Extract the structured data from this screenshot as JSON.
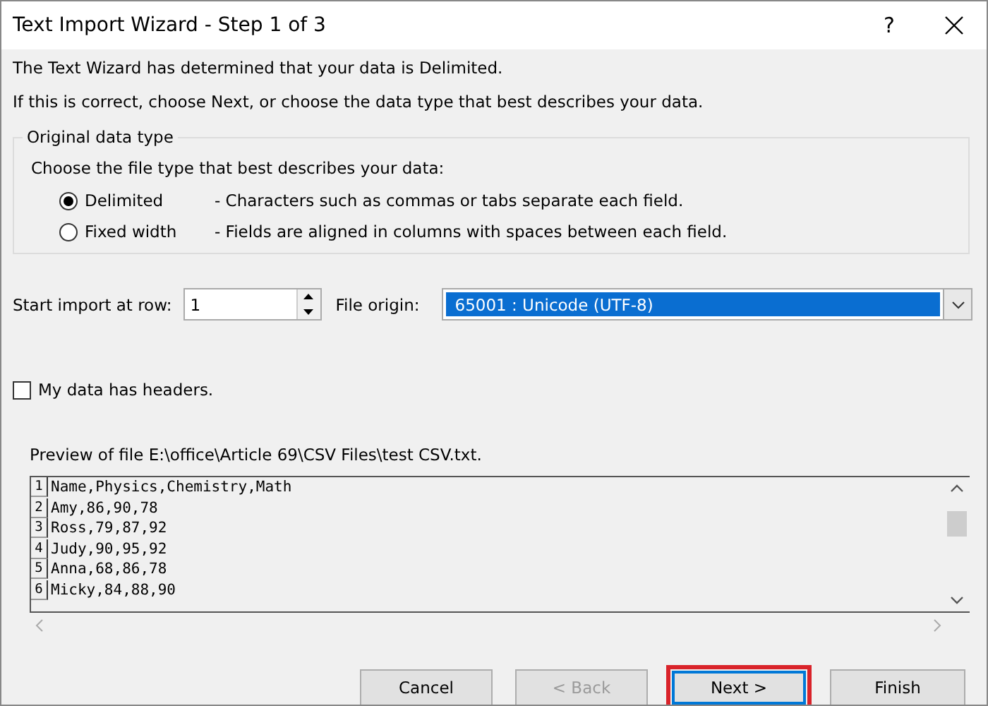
{
  "window": {
    "title": "Text Import Wizard - Step 1 of 3",
    "help": "?"
  },
  "intro": [
    "The Text Wizard has determined that your data is Delimited.",
    "If this is correct, choose Next, or choose the data type that best describes your data."
  ],
  "data_type_group": {
    "legend": "Original data type",
    "prompt": "Choose the file type that best describes your data:",
    "options": [
      {
        "label": "Delimited",
        "description": "- Characters such as commas or tabs separate each field.",
        "selected": true
      },
      {
        "label": "Fixed width",
        "description": "- Fields are aligned in columns with spaces between each field.",
        "selected": false
      }
    ]
  },
  "start_row": {
    "label": "Start import at row:",
    "value": "1"
  },
  "file_origin": {
    "label": "File origin:",
    "value": "65001 : Unicode (UTF-8)"
  },
  "headers_checkbox": {
    "label": "My data has headers.",
    "checked": false
  },
  "preview": {
    "title": "Preview of file E:\\office\\Article 69\\CSV Files\\test CSV.txt.",
    "lines": [
      {
        "number": "1",
        "text": "Name,Physics,Chemistry,Math"
      },
      {
        "number": "2",
        "text": "Amy,86,90,78"
      },
      {
        "number": "3",
        "text": "Ross,79,87,92"
      },
      {
        "number": "4",
        "text": "Judy,90,95,92"
      },
      {
        "number": "5",
        "text": "Anna,68,86,78"
      },
      {
        "number": "6",
        "text": "Micky,84,88,90"
      }
    ]
  },
  "buttons": [
    {
      "label": "Cancel",
      "disabled": false,
      "default": false,
      "highlighted": false
    },
    {
      "label": "< Back",
      "disabled": true,
      "default": false,
      "highlighted": false
    },
    {
      "label": "Next >",
      "disabled": false,
      "default": true,
      "highlighted": true
    },
    {
      "label": "Finish",
      "disabled": false,
      "default": false,
      "highlighted": false
    }
  ]
}
